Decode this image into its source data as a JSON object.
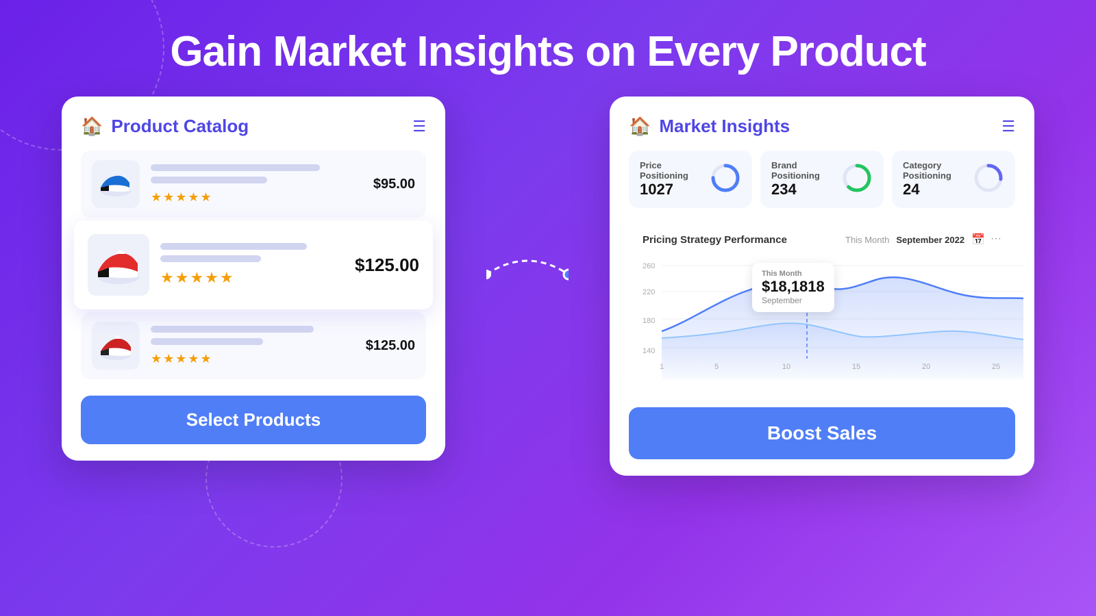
{
  "page": {
    "title": "Gain Market Insights on Every Product",
    "bg_gradient_start": "#6b21e8",
    "bg_gradient_end": "#a855f7"
  },
  "left_panel": {
    "title": "Product Catalog",
    "products": [
      {
        "emoji": "👟",
        "price": "$95.00",
        "stars": "★★★★★",
        "featured": false
      },
      {
        "emoji": "👟",
        "price": "$125.00",
        "stars": "★★★★★",
        "featured": true
      },
      {
        "emoji": "👟",
        "price": "$125.00",
        "stars": "★★★★★",
        "featured": false
      }
    ],
    "select_button_label": "Select Products"
  },
  "right_panel": {
    "title": "Market Insights",
    "stats": [
      {
        "label": "Price Positioning",
        "value": "1027",
        "donut_type": "price"
      },
      {
        "label": "Brand Positioning",
        "value": "234",
        "donut_type": "brand"
      },
      {
        "label": "Category Positioning",
        "value": "24",
        "donut_type": "category"
      }
    ],
    "chart": {
      "title": "Pricing Strategy Performance",
      "this_month_label": "This Month",
      "date_label": "September 2022",
      "tooltip": {
        "label": "This Month",
        "value": "$18,1818",
        "month": "September"
      },
      "x_labels": [
        "1",
        "5",
        "10",
        "15",
        "20",
        "25"
      ],
      "y_labels": [
        "260",
        "220",
        "180",
        "140"
      ]
    },
    "boost_button_label": "Boost Sales"
  }
}
